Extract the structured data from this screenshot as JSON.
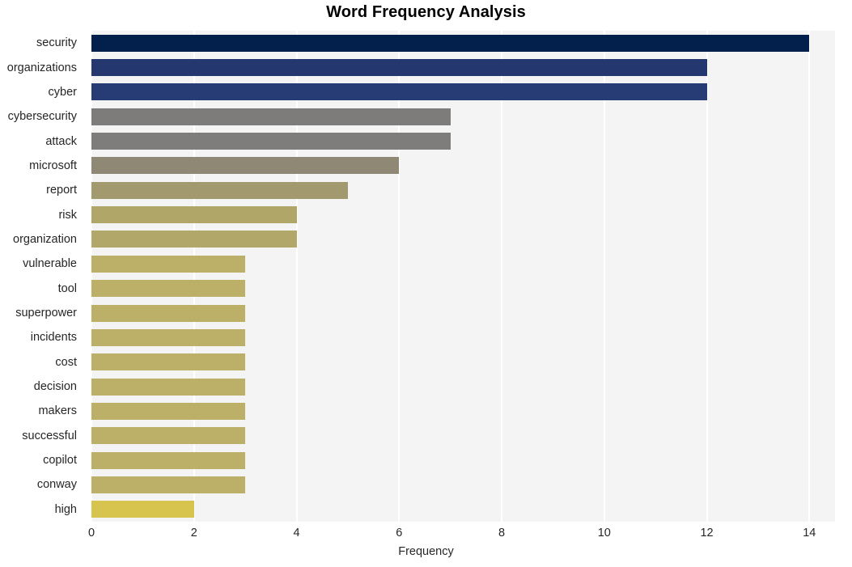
{
  "chart_data": {
    "type": "bar",
    "orientation": "horizontal",
    "title": "Word Frequency Analysis",
    "xlabel": "Frequency",
    "ylabel": "",
    "categories": [
      "security",
      "organizations",
      "cyber",
      "cybersecurity",
      "attack",
      "microsoft",
      "report",
      "risk",
      "organization",
      "vulnerable",
      "tool",
      "superpower",
      "incidents",
      "cost",
      "decision",
      "makers",
      "successful",
      "copilot",
      "conway",
      "high"
    ],
    "values": [
      14,
      12,
      12,
      7,
      7,
      6,
      5,
      4,
      4,
      3,
      3,
      3,
      3,
      3,
      3,
      3,
      3,
      3,
      3,
      2
    ],
    "xlim": [
      0,
      14.5
    ],
    "xticks": [
      0,
      2,
      4,
      6,
      8,
      10,
      12,
      14
    ],
    "xticklabels": [
      "0",
      "2",
      "4",
      "6",
      "8",
      "10",
      "12",
      "14"
    ],
    "grid": true,
    "legend": false,
    "bar_colors": [
      "#03204c",
      "#24386f",
      "#273c74",
      "#7d7c7b",
      "#7e7d7b",
      "#8e8874",
      "#a29a6e",
      "#b0a668",
      "#b1a768",
      "#bcb069",
      "#bcb069",
      "#bcb069",
      "#bcb069",
      "#bcb069",
      "#bcb069",
      "#bcb069",
      "#bcb069",
      "#bcb069",
      "#bcb069",
      "#d6c44e"
    ],
    "plot_background": "#f4f4f5",
    "gridline_color": "#ffffff",
    "text_color": "#262626"
  }
}
